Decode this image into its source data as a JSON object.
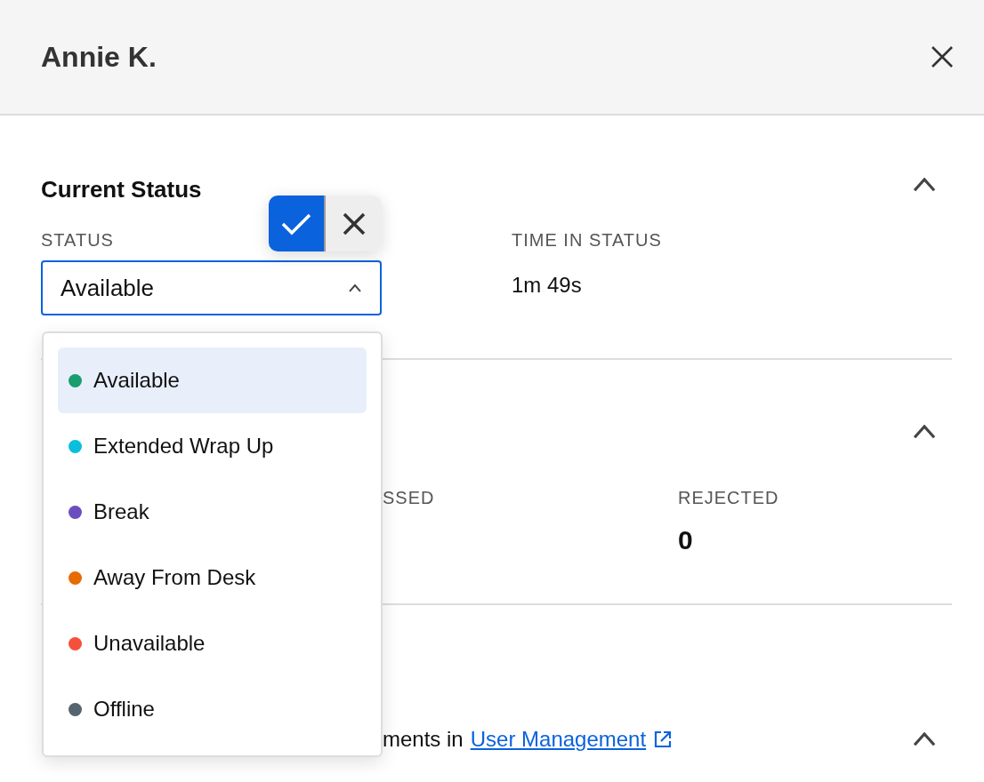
{
  "panel": {
    "title": "Annie K."
  },
  "sections": [
    {
      "heading": "Current Status",
      "expanded": true,
      "status": {
        "label": "STATUS",
        "value": "Available",
        "open": true,
        "options": [
          {
            "label": "Available",
            "color": "#1a9e6e",
            "selected": true
          },
          {
            "label": "Extended Wrap Up",
            "color": "#0bbfdc",
            "selected": false
          },
          {
            "label": "Break",
            "color": "#6b4fbf",
            "selected": false
          },
          {
            "label": "Away From Desk",
            "color": "#e66b00",
            "selected": false
          },
          {
            "label": "Unavailable",
            "color": "#f5503a",
            "selected": false
          },
          {
            "label": "Offline",
            "color": "#56646f",
            "selected": false
          }
        ]
      },
      "time": {
        "label": "TIME IN STATUS",
        "value": "1m 49s"
      }
    },
    {
      "expanded": true,
      "stats": [
        {
          "label": "SSED"
        },
        {
          "label": "REJECTED",
          "value": "0"
        }
      ]
    },
    {
      "expanded": true,
      "note": {
        "text": "ments in",
        "link": "User Management"
      }
    }
  ]
}
